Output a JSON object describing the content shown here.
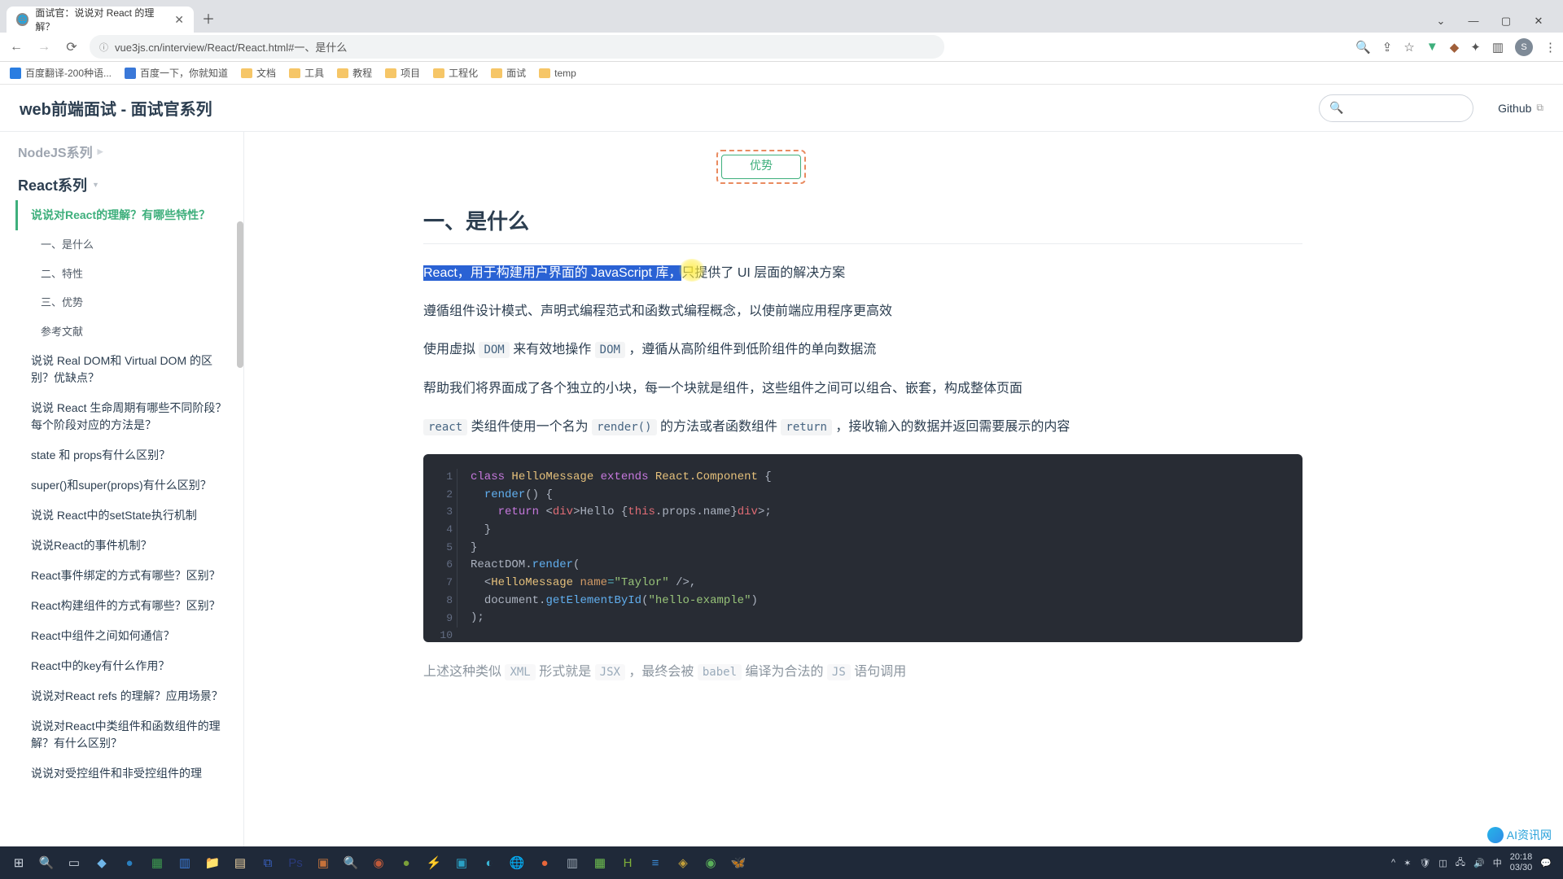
{
  "browser": {
    "tab_title": "面试官：说说对 React 的理解？",
    "url": "vue3js.cn/interview/React/React.html#一、是什么",
    "window_controls": {
      "min": "—",
      "max": "▢",
      "close": "✕",
      "drop": "⌄"
    }
  },
  "bookmarks": [
    {
      "label": "百度翻译-200种语...",
      "color": "#2a7de1"
    },
    {
      "label": "百度一下，你就知道",
      "color": "#3a78d8"
    },
    {
      "label": "文档",
      "folder": true
    },
    {
      "label": "工具",
      "folder": true
    },
    {
      "label": "教程",
      "folder": true
    },
    {
      "label": "项目",
      "folder": true
    },
    {
      "label": "工程化",
      "folder": true
    },
    {
      "label": "面试",
      "folder": true
    },
    {
      "label": "temp",
      "folder": true
    }
  ],
  "site": {
    "title": "web前端面试 - 面试官系列",
    "github_label": "Github",
    "search_placeholder": ""
  },
  "sidebar": {
    "prev_group": "NodeJS系列",
    "group": "React系列",
    "active_item": "说说对React的理解？有哪些特性？",
    "sub_items": [
      "一、是什么",
      "二、特性",
      "三、优势",
      "参考文献"
    ],
    "items": [
      "说说 Real DOM和 Virtual DOM 的区别？优缺点？",
      "说说 React 生命周期有哪些不同阶段？每个阶段对应的方法是？",
      "state 和 props有什么区别？",
      "super()和super(props)有什么区别？",
      "说说 React中的setState执行机制",
      "说说React的事件机制？",
      "React事件绑定的方式有哪些？区别？",
      "React构建组件的方式有哪些？区别？",
      "React中组件之间如何通信？",
      "React中的key有什么作用？",
      "说说对React refs 的理解？应用场景？",
      "说说对React中类组件和函数组件的理解？有什么区别？",
      "说说对受控组件和非受控组件的理"
    ]
  },
  "content": {
    "diagram_label": "优势",
    "h2": "一、是什么",
    "p1_highlight": "React，用于构建用户界面的 JavaScript 库，",
    "p1_marker_text": "只",
    "p1_rest": "提供了 UI 层面的解决方案",
    "p2": "遵循组件设计模式、声明式编程范式和函数式编程概念，以使前端应用程序更高效",
    "p3_a": "使用虚拟 ",
    "p3_code1": "DOM",
    "p3_b": " 来有效地操作 ",
    "p3_code2": "DOM",
    "p3_c": " ，遵循从高阶组件到低阶组件的单向数据流",
    "p4": "帮助我们将界面成了各个独立的小块，每一个块就是组件，这些组件之间可以组合、嵌套，构成整体页面",
    "p5_code1": "react",
    "p5_a": " 类组件使用一个名为 ",
    "p5_code2": "render()",
    "p5_b": " 的方法或者函数组件 ",
    "p5_code3": "return",
    "p5_c": " ，接收输入的数据并返回需要展示的内容",
    "footer_a": "上述这种类似 ",
    "footer_code1": "XML",
    "footer_b": " 形式就是 ",
    "footer_code2": "JSX",
    "footer_c": " ，最终会被 ",
    "footer_code3": "babel",
    "footer_d": " 编译为合法的 ",
    "footer_code4": "JS",
    "footer_e": " 语句调用"
  },
  "code": {
    "line_count": 10,
    "l1": {
      "kw1": "class",
      "cls": "HelloMessage",
      "kw2": "extends",
      "sup": "React.Component",
      "tail": " {"
    },
    "l2": {
      "indent": "  ",
      "fn": "render",
      "tail": "() {"
    },
    "l3": {
      "indent": "    ",
      "kw": "return",
      "sp": " ",
      "lt": "<",
      "tag": "div",
      "gt": ">",
      "txt": "Hello ",
      "ob": "{",
      "this": "this",
      "dot1": ".",
      "p1": "props",
      "dot2": ".",
      "p2": "name",
      "cb": "}",
      "lt2": "</",
      "tag2": "div",
      "gt2": ">",
      "semi": ";"
    },
    "l4": "  }",
    "l5": "}",
    "l6": "",
    "l7": {
      "obj": "ReactDOM",
      "dot": ".",
      "fn": "render",
      "tail": "("
    },
    "l8": {
      "indent": "  ",
      "lt": "<",
      "tag": "HelloMessage",
      "sp": " ",
      "attr": "name",
      "eq": "=",
      "str": "\"Taylor\"",
      "sp2": " ",
      "sl": "/>",
      "comma": ","
    },
    "l9": {
      "indent": "  ",
      "obj": "document",
      "dot": ".",
      "fn": "getElementById",
      "op": "(",
      "str": "\"hello-example\"",
      "cp": ")"
    },
    "l10": ");"
  },
  "taskbar": {
    "time": "20:18",
    "date": "03/30",
    "watermark": "AI资讯网"
  }
}
